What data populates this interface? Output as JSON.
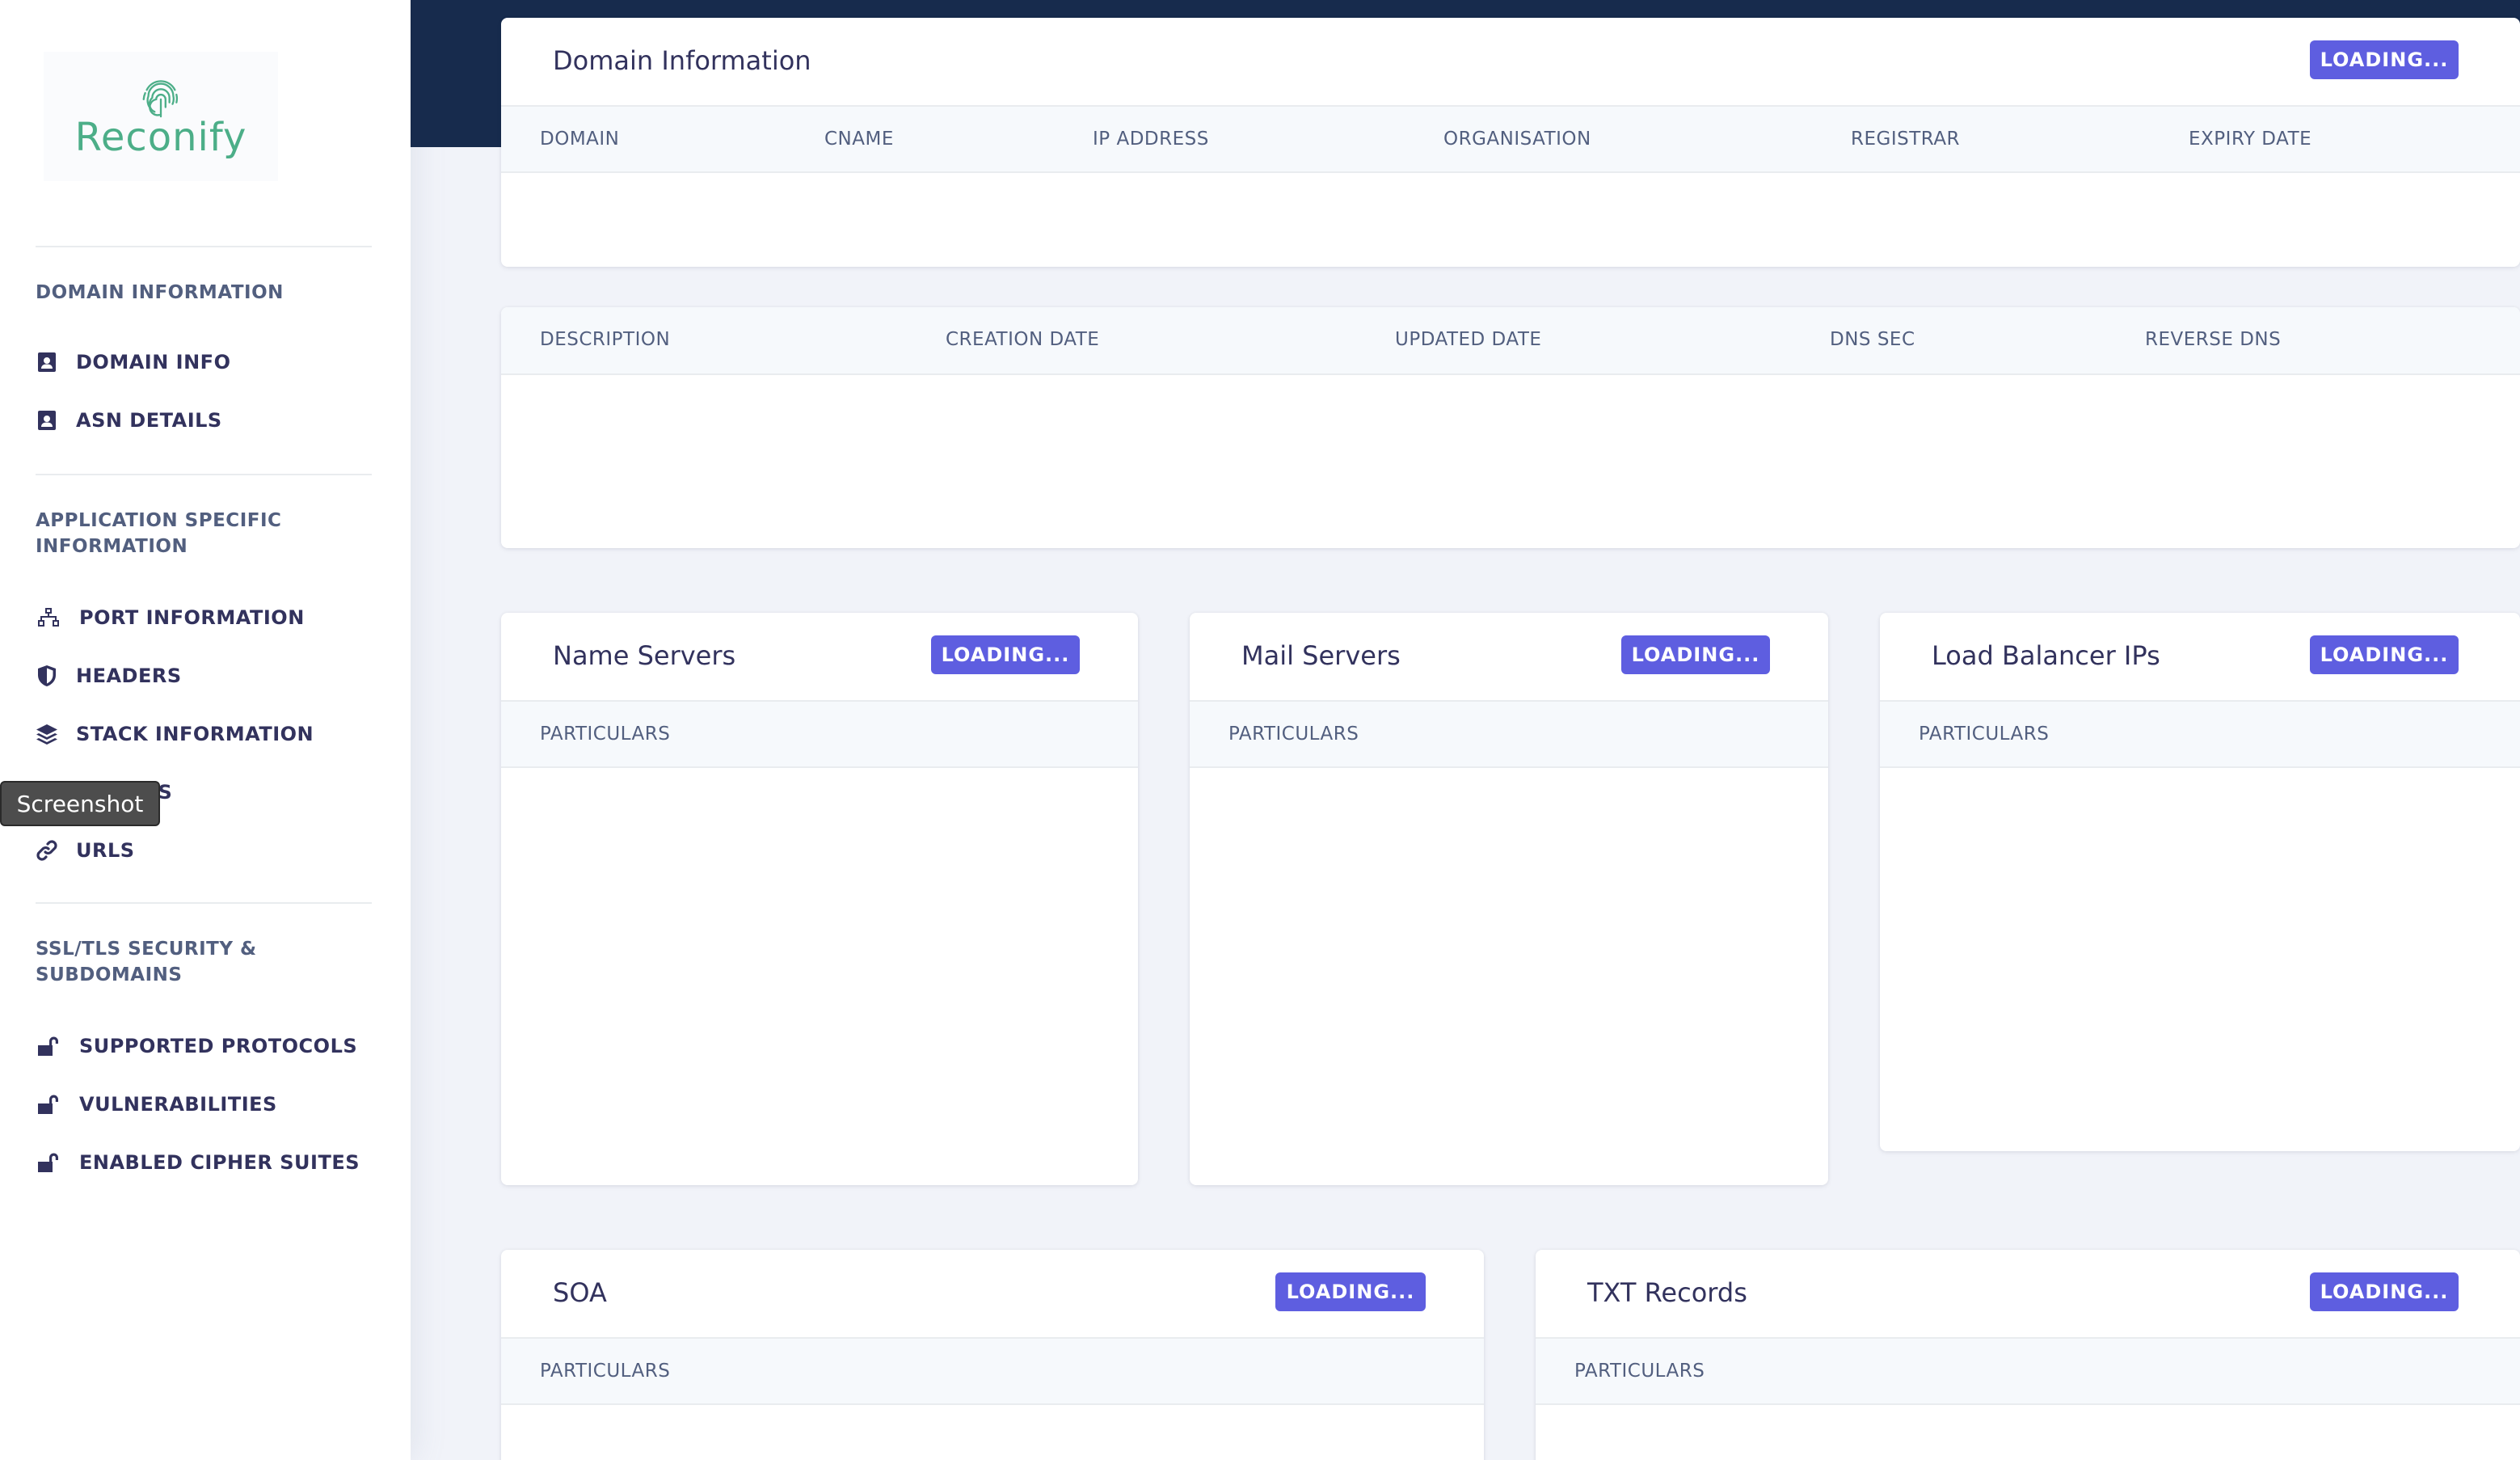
{
  "brand": {
    "name": "Reconify",
    "color": "#4cae88"
  },
  "accent": "#5e5ee0",
  "sidebar": {
    "sections": [
      {
        "heading": "DOMAIN INFORMATION",
        "items": [
          {
            "label": "DOMAIN INFO",
            "icon": "contact-card-icon"
          },
          {
            "label": "ASN DETAILS",
            "icon": "contact-card-icon"
          }
        ]
      },
      {
        "heading": "APPLICATION SPECIFIC INFORMATION",
        "items": [
          {
            "label": "PORT INFORMATION",
            "icon": "network-icon"
          },
          {
            "label": "HEADERS",
            "icon": "shield-icon"
          },
          {
            "label": "STACK INFORMATION",
            "icon": "layers-icon"
          },
          {
            "label": "MAINS",
            "icon": "sitemap-icon"
          },
          {
            "label": "URLS",
            "icon": "link-icon"
          }
        ]
      },
      {
        "heading": "SSL/TLS SECURITY & SUBDOMAINS",
        "items": [
          {
            "label": "SUPPORTED PROTOCOLS",
            "icon": "unlock-icon"
          },
          {
            "label": "VULNERABILITIES",
            "icon": "unlock-icon"
          },
          {
            "label": "ENABLED CIPHER SUITES",
            "icon": "unlock-icon"
          }
        ]
      }
    ]
  },
  "tooltip": "Screenshot",
  "loading_label": "LOADING...",
  "domain_card": {
    "title": "Domain Information",
    "columns": [
      "DOMAIN",
      "CNAME",
      "IP ADDRESS",
      "ORGANISATION",
      "REGISTRAR",
      "EXPIRY DATE"
    ]
  },
  "details_card": {
    "columns": [
      "DESCRIPTION",
      "CREATION DATE",
      "UPDATED DATE",
      "DNS SEC",
      "REVERSE DNS"
    ]
  },
  "name_servers": {
    "title": "Name Servers",
    "column": "PARTICULARS"
  },
  "mail_servers": {
    "title": "Mail Servers",
    "column": "PARTICULARS"
  },
  "load_balancer": {
    "title": "Load Balancer IPs",
    "column": "PARTICULARS"
  },
  "soa": {
    "title": "SOA",
    "column": "PARTICULARS"
  },
  "txt_records": {
    "title": "TXT Records",
    "column": "PARTICULARS"
  }
}
